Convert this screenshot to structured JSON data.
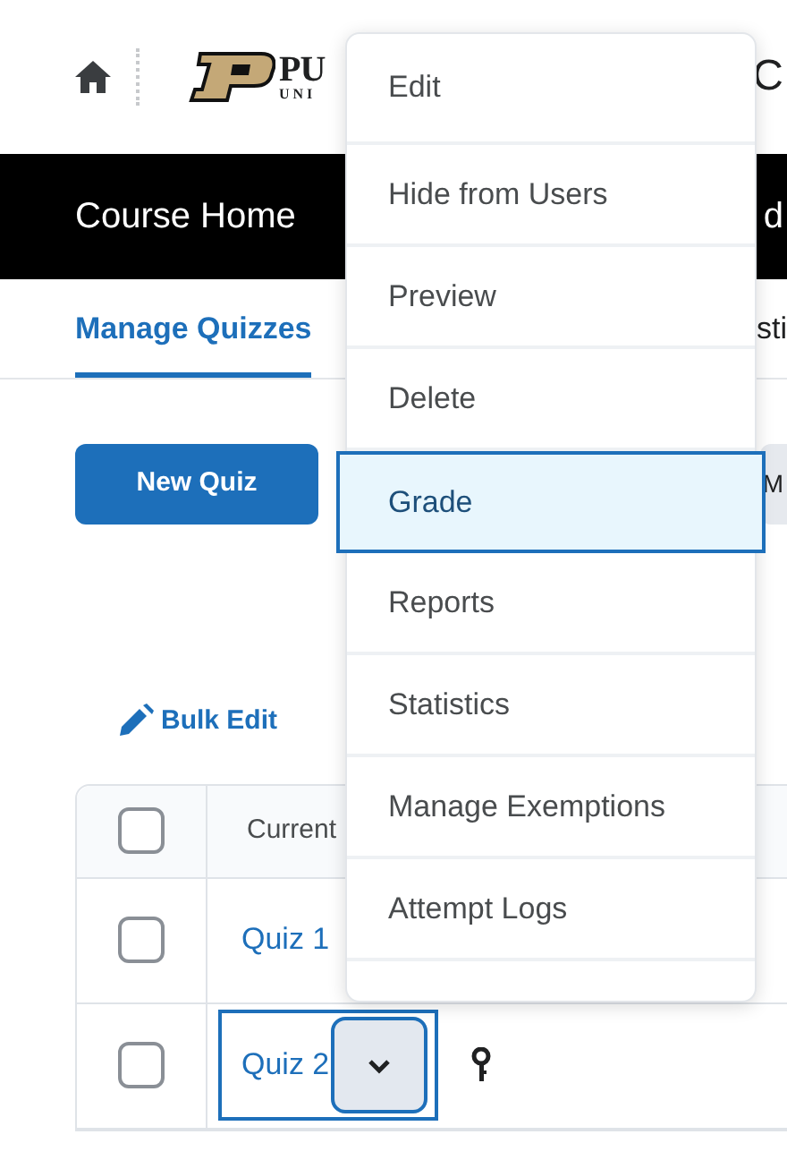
{
  "header": {
    "logo_text": "PU",
    "logo_subtext": "UNI",
    "title": "C"
  },
  "nav": {
    "items": [
      {
        "label": "Course Home"
      },
      {
        "label": "d"
      }
    ]
  },
  "tabs": [
    {
      "label": "Manage Quizzes",
      "selected": true
    },
    {
      "label": "sti",
      "selected": false
    }
  ],
  "toolbar": {
    "buttons": [
      {
        "label": "New Quiz",
        "kind": "primary"
      },
      {
        "label": "M",
        "kind": "secondary"
      }
    ]
  },
  "bulk_edit": {
    "label": "Bulk Edit"
  },
  "table": {
    "header_checkbox": {
      "checked": false
    },
    "columns": [
      "Current"
    ],
    "rows": [
      {
        "name": "Quiz 1",
        "checked": false,
        "focused": false
      },
      {
        "name": "Quiz 2",
        "checked": false,
        "focused": true,
        "locked": true
      }
    ]
  },
  "context_menu": {
    "items": [
      {
        "label": "Edit",
        "selected": false
      },
      {
        "label": "Hide from Users",
        "selected": false
      },
      {
        "label": "Preview",
        "selected": false
      },
      {
        "label": "Delete",
        "selected": false
      },
      {
        "label": "Grade",
        "selected": true
      },
      {
        "label": "Reports",
        "selected": false
      },
      {
        "label": "Statistics",
        "selected": false
      },
      {
        "label": "Manage Exemptions",
        "selected": false
      },
      {
        "label": "Attempt Logs",
        "selected": false
      }
    ]
  }
}
